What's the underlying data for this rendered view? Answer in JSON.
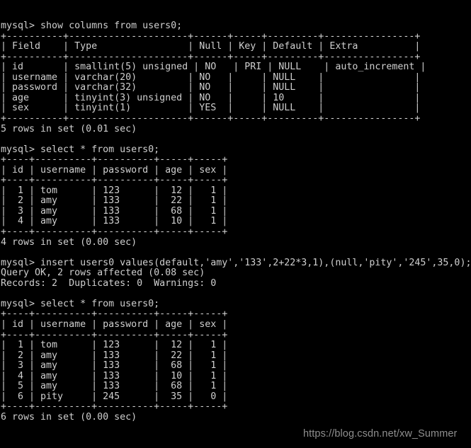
{
  "terminal": {
    "prompt": "mysql> ",
    "foreground_color": "#cfcfcf",
    "background_color": "#000000",
    "watermark": "https://blog.csdn.net/xw_Summer"
  },
  "lines": [
    "mysql> show columns from users0;",
    "+----------+---------------------+------+-----+---------+----------------+",
    "| Field    | Type                | Null | Key | Default | Extra          |",
    "+----------+---------------------+------+-----+---------+----------------+",
    "| id       | smallint(5) unsigned | NO   | PRI | NULL    | auto_increment |",
    "| username | varchar(20)         | NO   |     | NULL    |                |",
    "| password | varchar(32)         | NO   |     | NULL    |                |",
    "| age      | tinyint(3) unsigned | NO   |     | 10      |                |",
    "| sex      | tinyint(1)          | YES  |     | NULL    |                |",
    "+----------+---------------------+------+-----+---------+----------------+",
    "5 rows in set (0.01 sec)",
    "",
    "mysql> select * from users0;",
    "+----+----------+----------+-----+-----+",
    "| id | username | password | age | sex |",
    "+----+----------+----------+-----+-----+",
    "|  1 | tom      | 123      |  12 |   1 |",
    "|  2 | amy      | 133      |  22 |   1 |",
    "|  3 | amy      | 133      |  68 |   1 |",
    "|  4 | amy      | 133      |  10 |   1 |",
    "+----+----------+----------+-----+-----+",
    "4 rows in set (0.00 sec)",
    "",
    "mysql> insert users0 values(default,'amy','133',2+22*3,1),(null,'pity','245',35,0);",
    "Query OK, 2 rows affected (0.08 sec)",
    "Records: 2  Duplicates: 0  Warnings: 0",
    "",
    "mysql> select * from users0;",
    "+----+----------+----------+-----+-----+",
    "| id | username | password | age | sex |",
    "+----+----------+----------+-----+-----+",
    "|  1 | tom      | 123      |  12 |   1 |",
    "|  2 | amy      | 133      |  22 |   1 |",
    "|  3 | amy      | 133      |  68 |   1 |",
    "|  4 | amy      | 133      |  10 |   1 |",
    "|  5 | amy      | 133      |  68 |   1 |",
    "|  6 | pity     | 245      |  35 |   0 |",
    "+----+----------+----------+-----+-----+",
    "6 rows in set (0.00 sec)"
  ],
  "commands": [
    {
      "sequence": 1,
      "statement": "show columns from users0;",
      "result_footer": "5 rows in set (0.01 sec)"
    },
    {
      "sequence": 2,
      "statement": "select * from users0;",
      "result_footer": "4 rows in set (0.00 sec)"
    },
    {
      "sequence": 3,
      "statement": "insert users0 values(default,'amy','133',2+22*3,1),(null,'pity','245',35,0);",
      "status_lines": [
        "Query OK, 2 rows affected (0.08 sec)",
        "Records: 2  Duplicates: 0  Warnings: 0"
      ]
    },
    {
      "sequence": 4,
      "statement": "select * from users0;",
      "result_footer": "6 rows in set (0.00 sec)"
    }
  ],
  "tables": [
    {
      "name": "show-columns-users0",
      "headers": [
        "Field",
        "Type",
        "Null",
        "Key",
        "Default",
        "Extra"
      ],
      "rows": [
        [
          "id",
          "smallint(5) unsigned",
          "NO",
          "PRI",
          "NULL",
          "auto_increment"
        ],
        [
          "username",
          "varchar(20)",
          "NO",
          "",
          "NULL",
          ""
        ],
        [
          "password",
          "varchar(32)",
          "NO",
          "",
          "NULL",
          ""
        ],
        [
          "age",
          "tinyint(3) unsigned",
          "NO",
          "",
          "10",
          ""
        ],
        [
          "sex",
          "tinyint(1)",
          "YES",
          "",
          "NULL",
          ""
        ]
      ],
      "row_count": 5
    },
    {
      "name": "select-users0-before-insert",
      "headers": [
        "id",
        "username",
        "password",
        "age",
        "sex"
      ],
      "rows": [
        [
          "1",
          "tom",
          "123",
          "12",
          "1"
        ],
        [
          "2",
          "amy",
          "133",
          "22",
          "1"
        ],
        [
          "3",
          "amy",
          "133",
          "68",
          "1"
        ],
        [
          "4",
          "amy",
          "133",
          "10",
          "1"
        ]
      ],
      "row_count": 4
    },
    {
      "name": "select-users0-after-insert",
      "headers": [
        "id",
        "username",
        "password",
        "age",
        "sex"
      ],
      "rows": [
        [
          "1",
          "tom",
          "123",
          "12",
          "1"
        ],
        [
          "2",
          "amy",
          "133",
          "22",
          "1"
        ],
        [
          "3",
          "amy",
          "133",
          "68",
          "1"
        ],
        [
          "4",
          "amy",
          "133",
          "10",
          "1"
        ],
        [
          "5",
          "amy",
          "133",
          "68",
          "1"
        ],
        [
          "6",
          "pity",
          "245",
          "35",
          "0"
        ]
      ],
      "row_count": 6
    }
  ]
}
